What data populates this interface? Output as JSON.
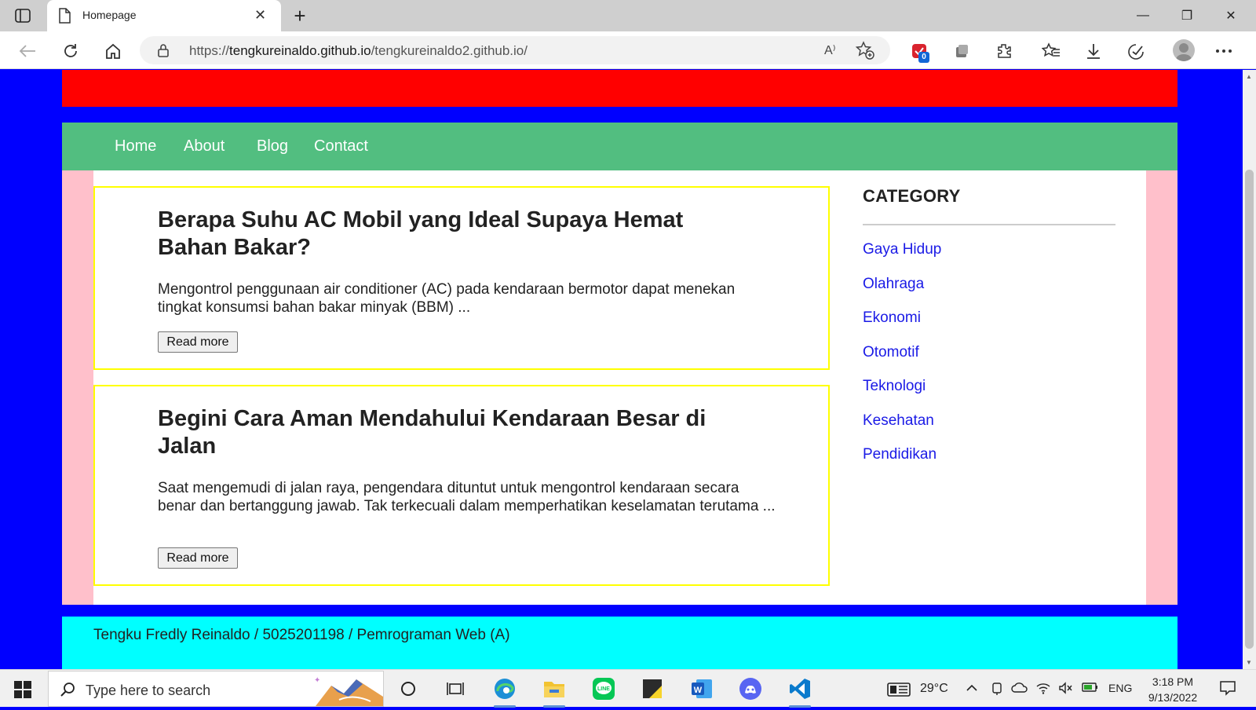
{
  "browser": {
    "tab_title": "Homepage",
    "close_tab_glyph": "✕",
    "new_tab_glyph": "+",
    "url_prefix": "https://",
    "url_host": "tengkureinaldo.github.io",
    "url_path": "/tengkureinaldo2.github.io/",
    "read_aloud_label": "A⁾",
    "extension_badge": "0",
    "window_controls": {
      "minimize": "—",
      "restore": "❐",
      "close": "✕"
    }
  },
  "page": {
    "colors": {
      "background": "#0000ff",
      "banner": "#ff0000",
      "nav": "#52be80",
      "content_side": "#ffc0cb",
      "article_border": "#ffff00",
      "footer": "#00ffff",
      "link": "#1a1ae6"
    },
    "nav": [
      {
        "label": "Home"
      },
      {
        "label": "About"
      },
      {
        "label": "Blog"
      },
      {
        "label": "Contact"
      }
    ],
    "articles": [
      {
        "title": "Berapa Suhu AC Mobil yang Ideal Supaya Hemat Bahan Bakar?",
        "excerpt": "Mengontrol penggunaan air conditioner (AC) pada kendaraan bermotor dapat menekan tingkat konsumsi bahan bakar minyak (BBM) ...",
        "button": "Read more"
      },
      {
        "title": "Begini Cara Aman Mendahului Kendaraan Besar di Jalan",
        "excerpt": "Saat mengemudi di jalan raya, pengendara dituntut untuk mengontrol kendaraan secara benar dan bertanggung jawab. Tak terkecuali dalam memperhatikan keselamatan terutama ...",
        "button": "Read more"
      }
    ],
    "sidebar": {
      "heading": "CATEGORY",
      "categories": [
        "Gaya Hidup",
        "Olahraga",
        "Ekonomi",
        "Otomotif",
        "Teknologi",
        "Kesehatan",
        "Pendidikan"
      ]
    },
    "footer": "Tengku Fredly Reinaldo / 5025201198 / Pemrograman Web (A)"
  },
  "taskbar": {
    "search_placeholder": "Type here to search",
    "temperature": "29°C",
    "language": "ENG",
    "time": "3:18 PM",
    "date": "9/13/2022"
  }
}
